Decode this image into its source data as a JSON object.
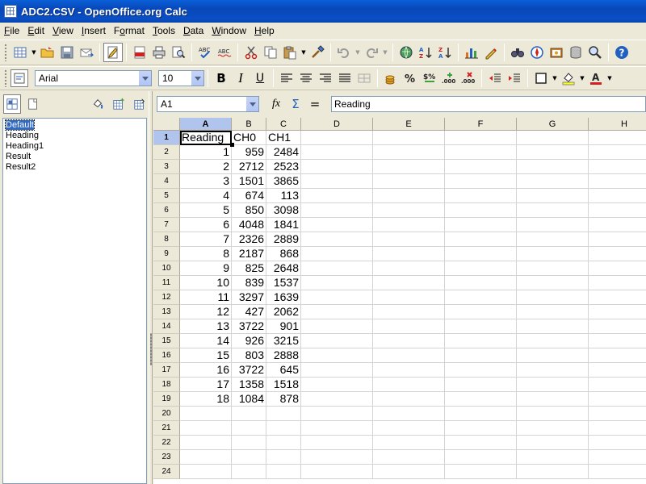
{
  "window": {
    "title": "ADC2.CSV - OpenOffice.org Calc"
  },
  "menu": [
    "File",
    "Edit",
    "View",
    "Insert",
    "Format",
    "Tools",
    "Data",
    "Window",
    "Help"
  ],
  "menu_underline": [
    "F",
    "E",
    "V",
    "I",
    "o",
    "T",
    "D",
    "W",
    "H"
  ],
  "format_toolbar": {
    "font_name": "Arial",
    "font_size": "10",
    "bold": "B",
    "italic": "I",
    "underline": "U"
  },
  "styles_panel": {
    "items": [
      "Default",
      "Heading",
      "Heading1",
      "Result",
      "Result2"
    ],
    "selected": "Default"
  },
  "formula_bar": {
    "name_box": "A1",
    "fx": "fx",
    "equals": "=",
    "content": "Reading"
  },
  "sheet": {
    "columns": [
      "A",
      "B",
      "C",
      "D",
      "E",
      "F",
      "G",
      "H"
    ],
    "active_column": "A",
    "active_row": 1,
    "row_numbers": [
      1,
      2,
      3,
      4,
      5,
      6,
      7,
      8,
      9,
      10,
      11,
      12,
      13,
      14,
      15,
      16,
      17,
      18,
      19,
      20,
      21,
      22,
      23,
      24
    ],
    "header_row": [
      "Reading",
      "CH0",
      "CH1"
    ],
    "data": [
      [
        1,
        959,
        2484
      ],
      [
        2,
        2712,
        2523
      ],
      [
        3,
        1501,
        3865
      ],
      [
        4,
        674,
        113
      ],
      [
        5,
        850,
        3098
      ],
      [
        6,
        4048,
        1841
      ],
      [
        7,
        2326,
        2889
      ],
      [
        8,
        2187,
        868
      ],
      [
        9,
        825,
        2648
      ],
      [
        10,
        839,
        1537
      ],
      [
        11,
        3297,
        1639
      ],
      [
        12,
        427,
        2062
      ],
      [
        13,
        3722,
        901
      ],
      [
        14,
        926,
        3215
      ],
      [
        15,
        803,
        2888
      ],
      [
        16,
        3722,
        645
      ],
      [
        17,
        1358,
        1518
      ],
      [
        18,
        1084,
        878
      ]
    ]
  }
}
